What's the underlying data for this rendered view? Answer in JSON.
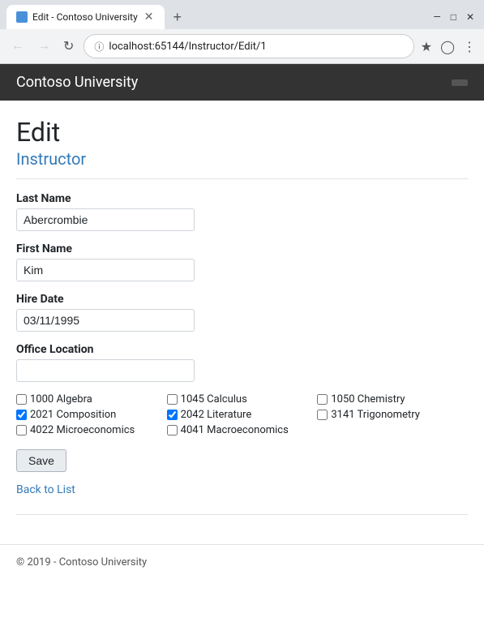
{
  "browser": {
    "tab_title": "Edit - Contoso University",
    "close_symbol": "✕",
    "new_tab_symbol": "+",
    "url": "localhost:65144/Instructor/Edit/1",
    "win_minimize": "—",
    "win_restore": "□",
    "win_close": "✕"
  },
  "header": {
    "app_name": "Contoso University",
    "btn_label": ""
  },
  "page": {
    "heading": "Edit",
    "subtitle": "Instructor"
  },
  "form": {
    "last_name_label": "Last Name",
    "last_name_value": "Abercrombie",
    "first_name_label": "First Name",
    "first_name_value": "Kim",
    "hire_date_label": "Hire Date",
    "hire_date_value": "03/11/1995",
    "office_label": "Office Location",
    "office_value": "",
    "save_label": "Save"
  },
  "courses": [
    {
      "id": "1000",
      "name": "Algebra",
      "checked": false
    },
    {
      "id": "1045",
      "name": "Calculus",
      "checked": false
    },
    {
      "id": "1050",
      "name": "Chemistry",
      "checked": false
    },
    {
      "id": "2021",
      "name": "Composition",
      "checked": true
    },
    {
      "id": "2042",
      "name": "Literature",
      "checked": true
    },
    {
      "id": "3141",
      "name": "Trigonometry",
      "checked": false
    },
    {
      "id": "4022",
      "name": "Microeconomics",
      "checked": false
    },
    {
      "id": "4041",
      "name": "Macroeconomics",
      "checked": false
    }
  ],
  "back_link": "Back to List",
  "footer": {
    "text": "© 2019 - Contoso University"
  }
}
